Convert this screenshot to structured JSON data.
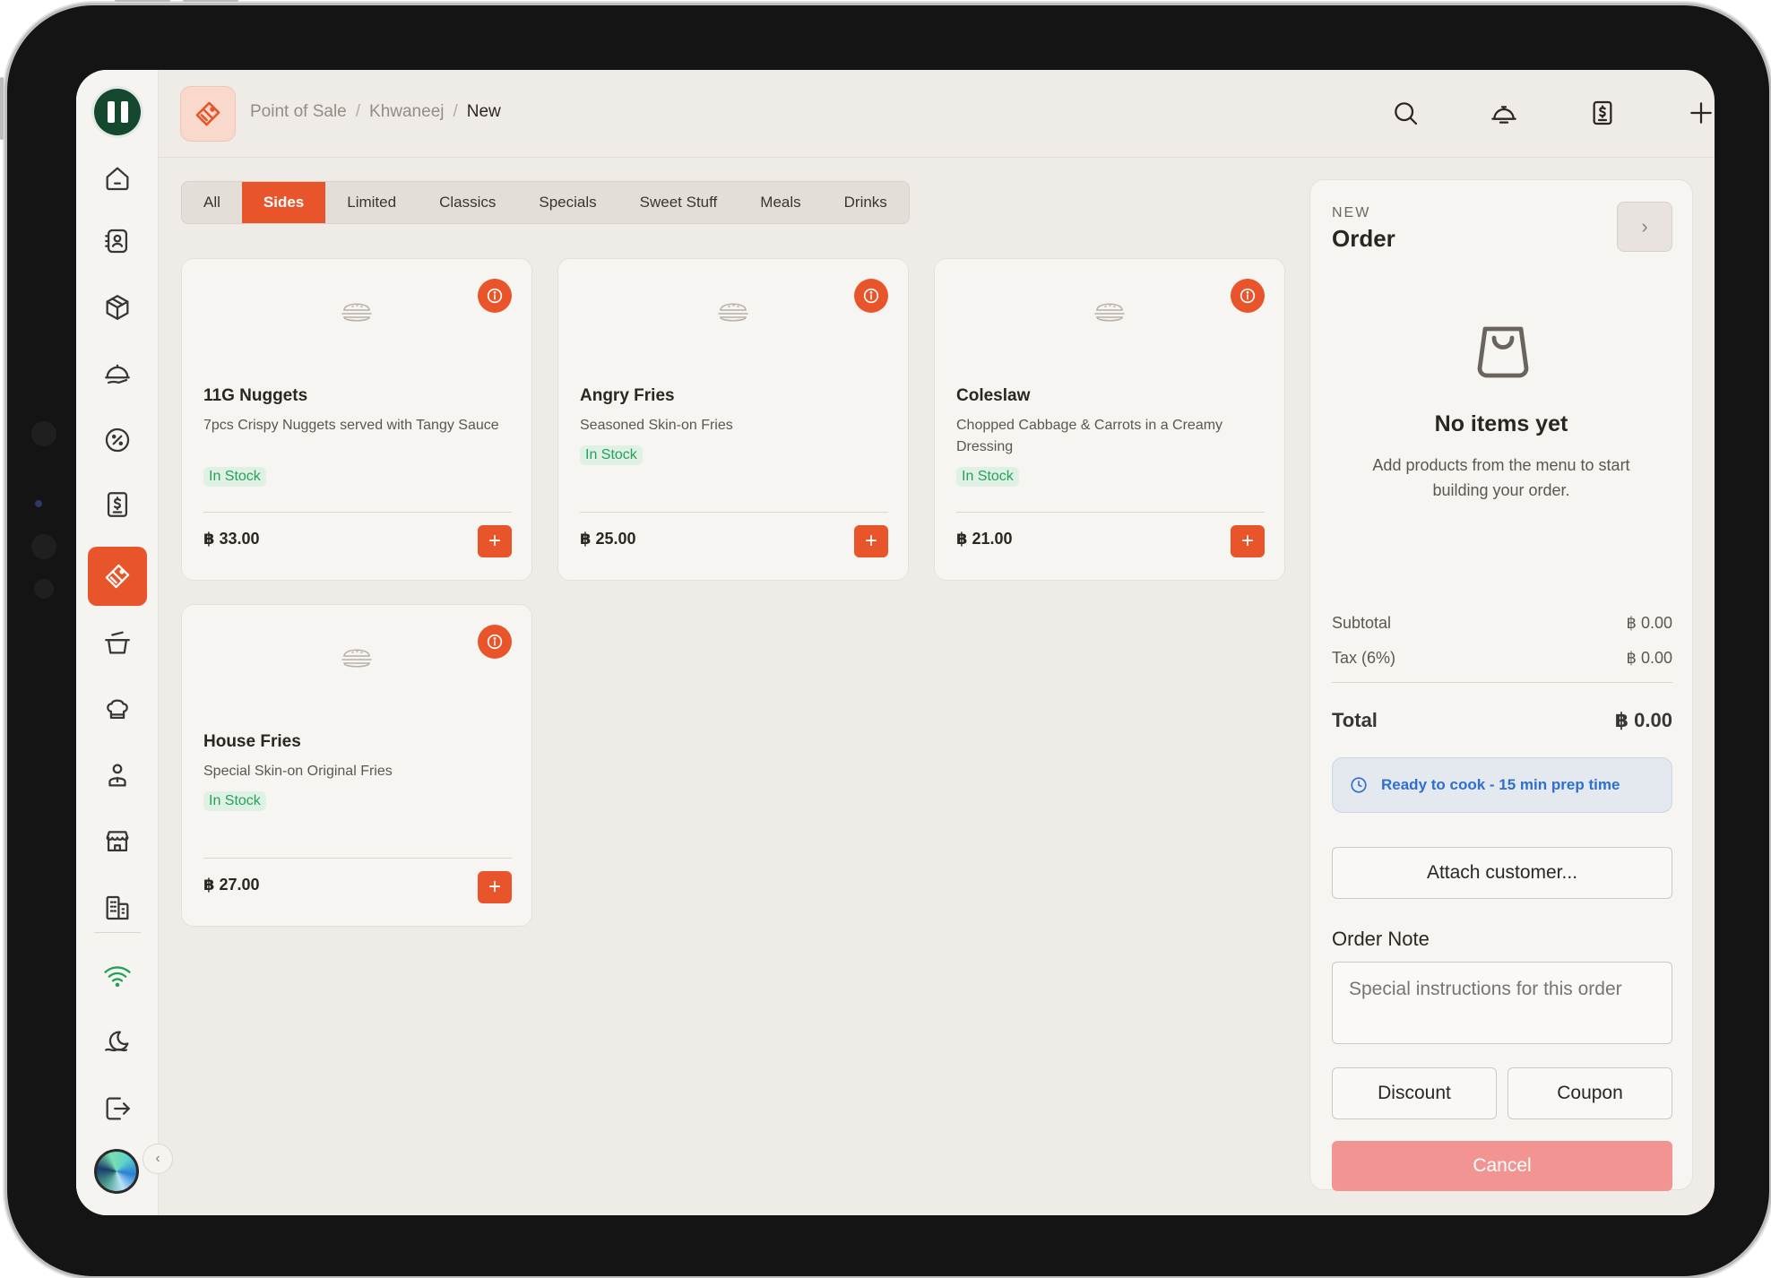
{
  "breadcrumb": {
    "root": "Point of Sale",
    "store": "Khwaneej",
    "current": "New",
    "separator": "/"
  },
  "categories": [
    {
      "label": "All",
      "active": false
    },
    {
      "label": "Sides",
      "active": true
    },
    {
      "label": "Limited",
      "active": false
    },
    {
      "label": "Classics",
      "active": false
    },
    {
      "label": "Specials",
      "active": false
    },
    {
      "label": "Sweet Stuff",
      "active": false
    },
    {
      "label": "Meals",
      "active": false
    },
    {
      "label": "Drinks",
      "active": false
    }
  ],
  "products": [
    {
      "name": "11G Nuggets",
      "description": "7pcs Crispy Nuggets served with Tangy Sauce",
      "stock": "In Stock",
      "price": "฿ 33.00"
    },
    {
      "name": "Angry Fries",
      "description": "Seasoned Skin-on Fries",
      "stock": "In Stock",
      "price": "฿ 25.00"
    },
    {
      "name": "Coleslaw",
      "description": "Chopped Cabbage & Carrots in a Creamy Dressing",
      "stock": "In Stock",
      "price": "฿ 21.00"
    },
    {
      "name": "House Fries",
      "description": "Special Skin-on Original Fries",
      "stock": "In Stock",
      "price": "฿ 27.00"
    }
  ],
  "order": {
    "kicker": "NEW",
    "title": "Order",
    "expand_glyph": "›",
    "empty_title": "No items yet",
    "empty_subtitle": "Add products from the menu to start building your order.",
    "subtotal_label": "Subtotal",
    "subtotal_value": "฿ 0.00",
    "tax_label": "Tax (6%)",
    "tax_value": "฿ 0.00",
    "total_label": "Total",
    "total_value": "฿ 0.00",
    "ready_text": "Ready to cook - 15 min prep time",
    "attach_customer": "Attach customer...",
    "note_label": "Order Note",
    "note_placeholder": "Special instructions for this order",
    "discount": "Discount",
    "coupon": "Coupon",
    "cancel": "Cancel"
  },
  "sidebar": {
    "icons": [
      "home-icon",
      "contacts-icon",
      "box-icon",
      "serving-icon",
      "discount-icon",
      "receipt-icon",
      "point-of-sale-icon",
      "cooking-pot-icon",
      "chef-hat-icon",
      "staff-icon",
      "store-icon",
      "buildings-icon",
      "wifi-icon",
      "theme-icon",
      "logout-icon"
    ],
    "active": "point-of-sale-icon",
    "collapse_glyph": "‹"
  },
  "colors": {
    "accent": "#e8552b",
    "brand": "#15492f",
    "in_stock": "#27a05a",
    "info": "#2f6fd0",
    "cancel": "#f29592"
  }
}
